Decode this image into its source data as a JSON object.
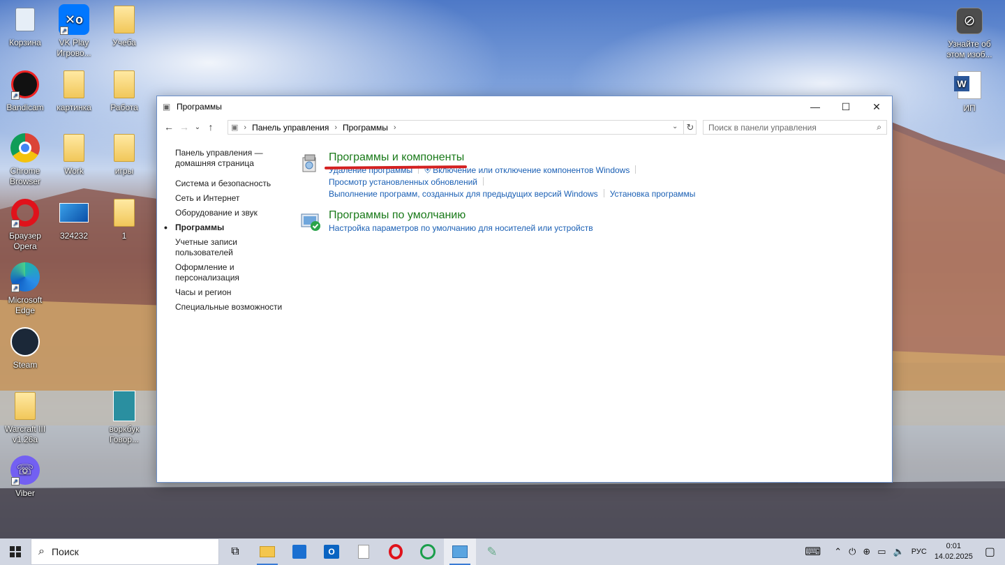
{
  "desktop": {
    "icons_left": [
      {
        "label": "Корзина",
        "icon": "recycle-bin-icon"
      },
      {
        "label": "VK Play Игрово...",
        "icon": "vk-play-icon"
      },
      {
        "label": "Учеба",
        "icon": "folder-icon"
      },
      {
        "label": "Bandicam",
        "icon": "bandicam-icon"
      },
      {
        "label": "картинка",
        "icon": "folder-icon"
      },
      {
        "label": "Работа",
        "icon": "folder-icon"
      },
      {
        "label": "Chrome Browser",
        "icon": "chrome-icon"
      },
      {
        "label": "Work",
        "icon": "folder-icon"
      },
      {
        "label": "игры",
        "icon": "folder-icon"
      },
      {
        "label": "Браузер Opera",
        "icon": "opera-icon"
      },
      {
        "label": "324232",
        "icon": "image-file-icon"
      },
      {
        "label": "1",
        "icon": "folder-icon"
      },
      {
        "label": "Microsoft Edge",
        "icon": "edge-icon"
      },
      {
        "label": "Steam",
        "icon": "steam-icon"
      },
      {
        "label": "Warcraft III v1.26a",
        "icon": "folder-icon"
      },
      {
        "label": "воркбук Говор...",
        "icon": "document-icon"
      },
      {
        "label": "Viber",
        "icon": "viber-icon"
      }
    ],
    "icons_right": [
      {
        "label": "Узнайте об этом изоб...",
        "icon": "camera-icon"
      },
      {
        "label": "ИП",
        "icon": "word-icon"
      }
    ]
  },
  "window": {
    "title": "Программы",
    "address": {
      "crumbs": [
        "Панель управления",
        "Программы"
      ]
    },
    "search_placeholder": "Поиск в панели управления",
    "sidebar": {
      "home": "Панель управления — домашняя страница",
      "items": [
        "Система и безопасность",
        "Сеть и Интернет",
        "Оборудование и звук",
        "Программы",
        "Учетные записи пользователей",
        "Оформление и персонализация",
        "Часы и регион",
        "Специальные возможности"
      ],
      "current": "Программы"
    },
    "sections": [
      {
        "title": "Программы и компоненты",
        "links_row1": [
          "Удаление программы",
          "Включение или отключение компонентов Windows"
        ],
        "links_row2": [
          "Просмотр установленных обновлений"
        ],
        "links_row3": [
          "Выполнение программ, созданных для предыдущих версий Windows",
          "Установка программы"
        ]
      },
      {
        "title": "Программы по умолчанию",
        "links_row1": [
          "Настройка параметров по умолчанию для носителей или устройств"
        ]
      }
    ]
  },
  "taskbar": {
    "search_label": "Поиск",
    "apps": [
      "task-view-icon",
      "file-explorer-icon",
      "store-icon",
      "outlook-icon",
      "file-icon",
      "opera-icon",
      "whatsapp-icon",
      "control-panel-icon",
      "paint-icon"
    ],
    "language": "РУС",
    "time": "0:01",
    "date": "14.02.2025"
  }
}
